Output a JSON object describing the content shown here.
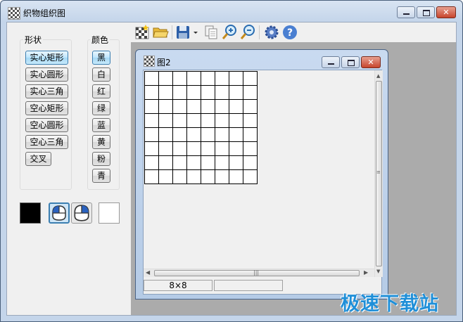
{
  "window": {
    "title": "织物组织图"
  },
  "shape_group": {
    "title": "形状",
    "buttons": [
      "实心矩形",
      "实心圆形",
      "实心三角",
      "空心矩形",
      "空心圆形",
      "空心三角",
      "交叉"
    ]
  },
  "color_group": {
    "title": "颜色",
    "buttons": [
      "黑",
      "白",
      "红",
      "绿",
      "蓝",
      "黄",
      "粉",
      "青"
    ]
  },
  "swatches": {
    "foreground": "#000000",
    "background": "#ffffff"
  },
  "toolbar": {
    "icons": [
      "new-weave-icon",
      "open-folder-icon",
      "save-icon",
      "dropdown-arrow-icon",
      "copy-icon",
      "zoom-in-icon",
      "zoom-out-icon",
      "settings-icon",
      "help-icon"
    ]
  },
  "child_window": {
    "title": "图2",
    "grid": {
      "rows": 8,
      "cols": 8
    },
    "status": {
      "size": "8×8",
      "extra": ""
    }
  },
  "watermark": "极速下载站",
  "colors": {
    "accent": "#3c7fb1",
    "close_button": "#c7452c",
    "workspace": "#ababab"
  }
}
